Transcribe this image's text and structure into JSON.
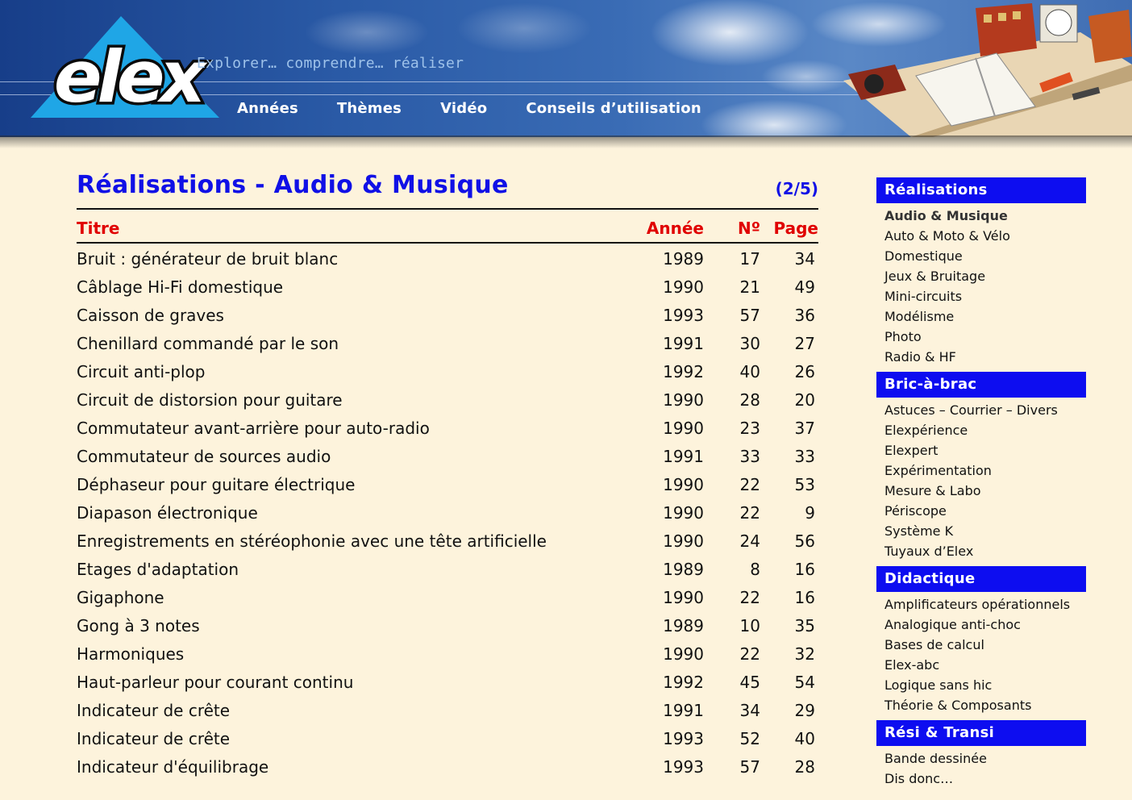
{
  "header": {
    "logo_text": "elex",
    "tagline": "Explorer… comprendre… réaliser",
    "nav": [
      "Années",
      "Thèmes",
      "Vidéo",
      "Conseils d’utilisation"
    ]
  },
  "main": {
    "title": "Réalisations - Audio & Musique",
    "page_counter": "(2/5)",
    "columns": {
      "title": "Titre",
      "year": "Année",
      "no": "Nº",
      "page": "Page"
    },
    "rows": [
      {
        "title": "Bruit : générateur de bruit blanc",
        "year": "1989",
        "no": "17",
        "page": "34"
      },
      {
        "title": "Câblage Hi-Fi domestique",
        "year": "1990",
        "no": "21",
        "page": "49"
      },
      {
        "title": "Caisson de graves",
        "year": "1993",
        "no": "57",
        "page": "36"
      },
      {
        "title": "Chenillard commandé par le son",
        "year": "1991",
        "no": "30",
        "page": "27"
      },
      {
        "title": "Circuit anti-plop",
        "year": "1992",
        "no": "40",
        "page": "26"
      },
      {
        "title": "Circuit de distorsion pour guitare",
        "year": "1990",
        "no": "28",
        "page": "20"
      },
      {
        "title": "Commutateur avant-arrière pour auto-radio",
        "year": "1990",
        "no": "23",
        "page": "37"
      },
      {
        "title": "Commutateur de sources audio",
        "year": "1991",
        "no": "33",
        "page": "33"
      },
      {
        "title": "Déphaseur pour guitare électrique",
        "year": "1990",
        "no": "22",
        "page": "53"
      },
      {
        "title": "Diapason électronique",
        "year": "1990",
        "no": "22",
        "page": "9"
      },
      {
        "title": "Enregistrements en stéréophonie avec une tête artificielle",
        "year": "1990",
        "no": "24",
        "page": "56"
      },
      {
        "title": "Etages d'adaptation",
        "year": "1989",
        "no": "8",
        "page": "16"
      },
      {
        "title": "Gigaphone",
        "year": "1990",
        "no": "22",
        "page": "16"
      },
      {
        "title": "Gong à 3 notes",
        "year": "1989",
        "no": "10",
        "page": "35"
      },
      {
        "title": "Harmoniques",
        "year": "1990",
        "no": "22",
        "page": "32"
      },
      {
        "title": "Haut-parleur pour courant continu",
        "year": "1992",
        "no": "45",
        "page": "54"
      },
      {
        "title": "Indicateur de crête",
        "year": "1991",
        "no": "34",
        "page": "29"
      },
      {
        "title": "Indicateur de crête",
        "year": "1993",
        "no": "52",
        "page": "40"
      },
      {
        "title": "Indicateur d'équilibrage",
        "year": "1993",
        "no": "57",
        "page": "28"
      }
    ]
  },
  "sidebar": {
    "sections": [
      {
        "title": "Réalisations",
        "items": [
          "Audio & Musique",
          "Auto & Moto & Vélo",
          "Domestique",
          "Jeux & Bruitage",
          "Mini-circuits",
          "Modélisme",
          "Photo",
          "Radio & HF"
        ],
        "active": "Audio & Musique"
      },
      {
        "title": "Bric-à-brac",
        "items": [
          "Astuces – Courrier – Divers",
          "Elexpérience",
          "Elexpert",
          "Expérimentation",
          "Mesure & Labo",
          "Périscope",
          "Système K",
          "Tuyaux d’Elex"
        ]
      },
      {
        "title": "Didactique",
        "items": [
          "Amplificateurs opérationnels",
          "Analogique anti-choc",
          "Bases de calcul",
          "Elex-abc",
          "Logique sans hic",
          "Théorie & Composants"
        ]
      },
      {
        "title": "Rési & Transi",
        "items": [
          "Bande dessinée",
          "Dis donc…"
        ]
      }
    ]
  },
  "colors": {
    "title_blue": "#1010e6",
    "header_red": "#e00000",
    "sidebar_head_bg": "#0d0df0",
    "page_bg": "#fdf3dc",
    "logo_triangle": "#1fa6e6"
  }
}
